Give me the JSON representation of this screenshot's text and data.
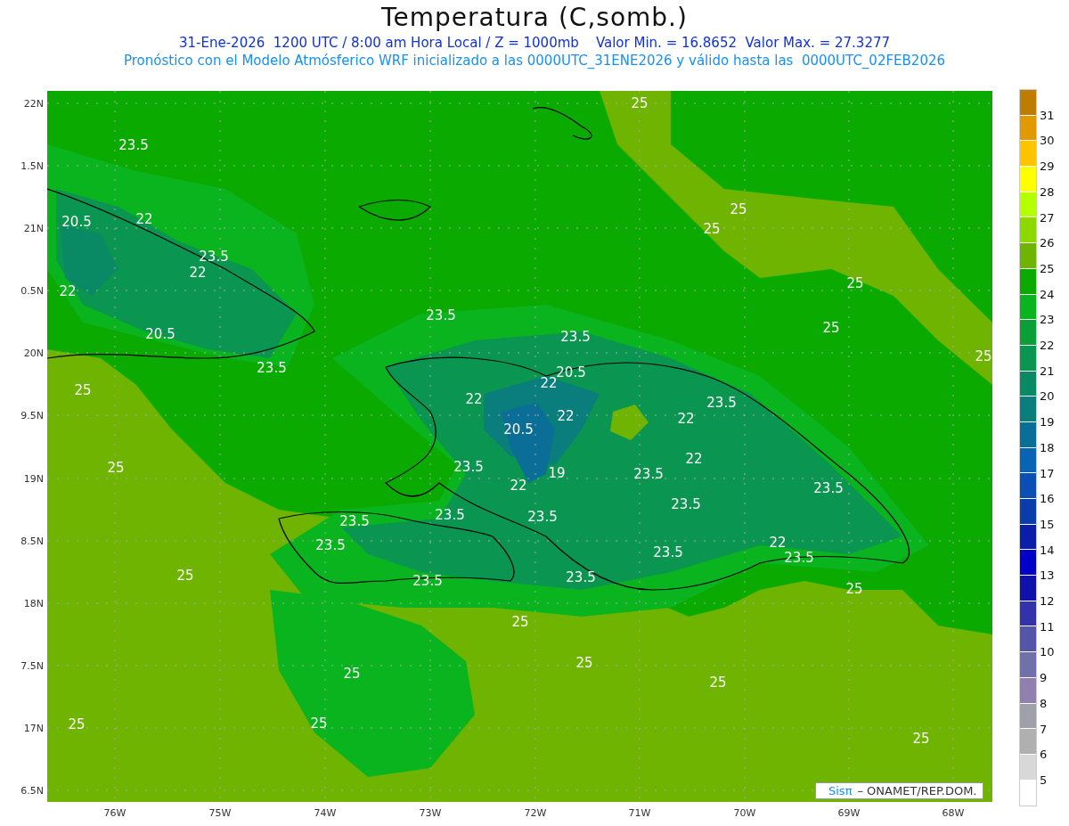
{
  "title": "Temperatura (C,somb.)",
  "subtitles": [
    "31-Ene-2026  1200 UTC / 8:00 am Hora Local / Z = 1000mb    Valor Min. = 16.8652  Valor Max. = 27.3277",
    "Pronóstico con el Modelo Atmósferico WRF inicializado a las 0000UTC_31ENE2026 y válido hasta las  0000UTC_02FEB2026"
  ],
  "lat_labels": [
    "22N",
    "1.5N",
    "21N",
    "0.5N",
    "20N",
    "9.5N",
    "19N",
    "8.5N",
    "18N",
    "7.5N",
    "17N",
    "6.5N"
  ],
  "lon_labels": [
    "76W",
    "75W",
    "74W",
    "73W",
    "72W",
    "71W",
    "70W",
    "69W",
    "68W"
  ],
  "contour_labels": [
    "23.5",
    "20.5",
    "22",
    "23.5",
    "22",
    "22",
    "20.5",
    "23.5",
    "25",
    "23.5",
    "23.5",
    "20.5",
    "22",
    "22",
    "22",
    "20.5",
    "22",
    "23.5",
    "22",
    "19",
    "22",
    "23.5",
    "23.5",
    "23.5",
    "23.5",
    "23.5",
    "23.5",
    "23.5",
    "23.5",
    "22",
    "23.5",
    "23.5",
    "25",
    "23.5",
    "23.5",
    "25",
    "25",
    "25",
    "25",
    "25",
    "25",
    "25",
    "25",
    "25",
    "25",
    "25",
    "25",
    "25",
    "25",
    "25"
  ],
  "credit": {
    "logo": "Sisπ",
    "text": "– ONAMET/REP.DOM."
  },
  "colorbar": {
    "segments": [
      {
        "color": "#bf7d00"
      },
      {
        "color": "#e09a00"
      },
      {
        "color": "#ffc300"
      },
      {
        "color": "#ffff00"
      },
      {
        "color": "#b4ff00"
      },
      {
        "color": "#8cd800"
      },
      {
        "color": "#6eb400"
      },
      {
        "color": "#0aaa00"
      },
      {
        "color": "#0ab41e"
      },
      {
        "color": "#0aa037"
      },
      {
        "color": "#0a9650"
      },
      {
        "color": "#0a8a64"
      },
      {
        "color": "#0a7d7d"
      },
      {
        "color": "#0a6e96"
      },
      {
        "color": "#0a64b4"
      },
      {
        "color": "#0a50b4"
      },
      {
        "color": "#0a3caa"
      },
      {
        "color": "#0a1eaa"
      },
      {
        "color": "#0000c8"
      },
      {
        "color": "#1010aa"
      },
      {
        "color": "#3232aa"
      },
      {
        "color": "#5555aa"
      },
      {
        "color": "#7070aa"
      },
      {
        "color": "#9080b0"
      },
      {
        "color": "#a0a0aa"
      },
      {
        "color": "#b0b0b0"
      },
      {
        "color": "#d8d8d8"
      },
      {
        "color": "#ffffff"
      }
    ],
    "labels": [
      "31",
      "30",
      "29",
      "28",
      "27",
      "26",
      "25",
      "24",
      "23",
      "22",
      "21",
      "20",
      "19",
      "18",
      "17",
      "16",
      "15",
      "14",
      "13",
      "12",
      "11",
      "10",
      "9",
      "8",
      "7",
      "6",
      "5"
    ]
  }
}
